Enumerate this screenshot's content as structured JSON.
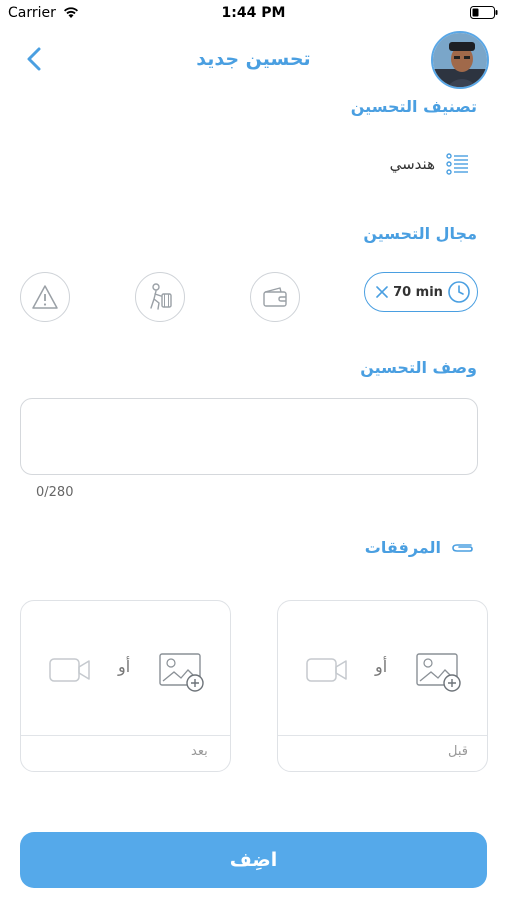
{
  "status_bar": {
    "carrier": "Carrier",
    "time": "1:44 PM"
  },
  "header": {
    "title": "تحسين جديد"
  },
  "classification": {
    "label": "تصنيف التحسين",
    "value": "هندسي"
  },
  "field": {
    "label": "مجال التحسين",
    "time_value": "70 min"
  },
  "description": {
    "label": "وصف التحسين",
    "value": "",
    "counter": "0/280"
  },
  "attachments": {
    "label": "المرفقات",
    "or_text": "أو",
    "before_caption": "قبل",
    "after_caption": "بعد"
  },
  "submit": {
    "label": "اضِف"
  },
  "colors": {
    "accent": "#4a9fe1",
    "button": "#55a9ea",
    "border": "#d5d8dc"
  }
}
